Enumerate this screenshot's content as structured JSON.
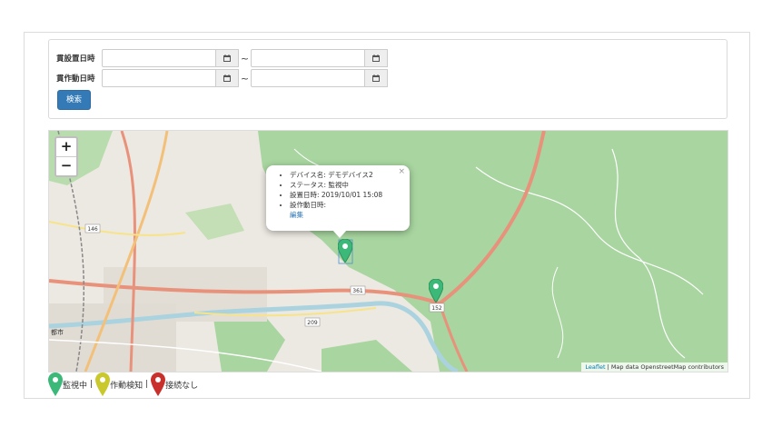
{
  "search": {
    "label_install_date": "貫設置日時",
    "label_operation_date": "貫作動日時",
    "separator": "~",
    "search_button": "検索"
  },
  "map": {
    "zoom_in": "+",
    "zoom_out": "−",
    "popup": {
      "items": [
        "デバイス名: デモデバイス2",
        "ステータス: 監視中",
        "設置日時: 2019/10/01 15:08",
        "設作動日時:"
      ],
      "edit_link": "編集",
      "close": "×"
    },
    "attribution_leaflet": "Leaflet",
    "attribution_rest": " | Map data OpenstreetMap contributors",
    "place_labels": {
      "road_361": "361",
      "road_152": "152",
      "road_209": "209",
      "road_146": "146",
      "city": "都市"
    }
  },
  "legend": {
    "monitoring": "監視中",
    "sep1": "|",
    "detected": "作動検知",
    "sep2": "|",
    "disconnected": "接続なし"
  },
  "colors": {
    "green_marker": "#3cb878",
    "yellow_marker": "#c9c82d",
    "red_marker": "#c9302c",
    "button": "#337ab7",
    "forest": "#a8d5a0",
    "road": "#e8927c"
  }
}
